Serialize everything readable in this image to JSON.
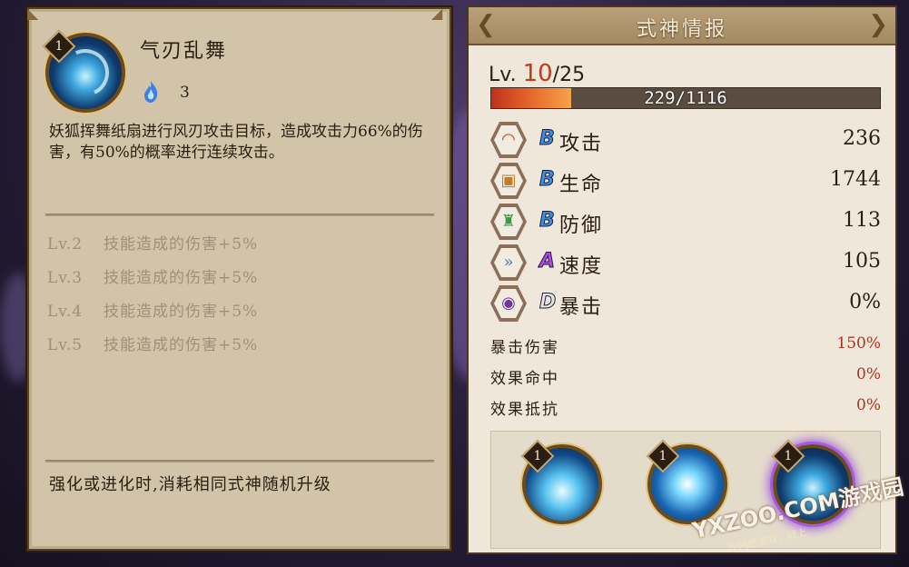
{
  "skill": {
    "icon": "wind-blade-skill-icon",
    "level_badge": "1",
    "name": "气刃乱舞",
    "cost_icon": "blue-onibi-flame-icon",
    "cost": "3",
    "description": "妖狐挥舞纸扇进行风刃攻击目标，造成攻击力66%的伤害，有50%的概率进行连续攻击。",
    "upgrades": [
      {
        "level": "Lv.2",
        "text": "技能造成的伤害+5%"
      },
      {
        "level": "Lv.3",
        "text": "技能造成的伤害+5%"
      },
      {
        "level": "Lv.4",
        "text": "技能造成的伤害+5%"
      },
      {
        "level": "Lv.5",
        "text": "技能造成的伤害+5%"
      }
    ],
    "footer_note": "强化或进化时,消耗相同式神随机升级"
  },
  "stats": {
    "title": "式神情报",
    "level_prefix": "Lv.",
    "level_current": "10",
    "level_max": "/25",
    "exp_text": "229/1116",
    "exp_fraction": 0.205,
    "rows": [
      {
        "icon": "attack-fan-icon",
        "grade": "B",
        "grade_color": "#3a8fe0",
        "name": "攻击",
        "value": "236"
      },
      {
        "icon": "health-scroll-icon",
        "grade": "B",
        "grade_color": "#3a8fe0",
        "name": "生命",
        "value": "1744"
      },
      {
        "icon": "defense-armor-icon",
        "grade": "B",
        "grade_color": "#3a8fe0",
        "name": "防御",
        "value": "113"
      },
      {
        "icon": "speed-chevron-icon",
        "grade": "A",
        "grade_color": "#b04ae0",
        "name": "速度",
        "value": "105"
      },
      {
        "icon": "crit-card-icon",
        "grade": "D",
        "grade_color": "#e8e4dc",
        "name": "暴击",
        "value": "0%"
      }
    ],
    "secondary": [
      {
        "name": "暴击伤害",
        "value": "150%"
      },
      {
        "name": "效果命中",
        "value": "0%"
      },
      {
        "name": "效果抵抗",
        "value": "0%"
      }
    ],
    "skills": [
      {
        "badge": "1",
        "icon": "wind-burst-skill-icon"
      },
      {
        "badge": "1",
        "icon": "whirlwind-skill-icon"
      },
      {
        "badge": "1",
        "icon": "wind-blade-skill-icon-selected"
      }
    ]
  },
  "watermark": {
    "main": "YXZOO.COM游戏园",
    "sub": "玩网络游戏，就上"
  }
}
